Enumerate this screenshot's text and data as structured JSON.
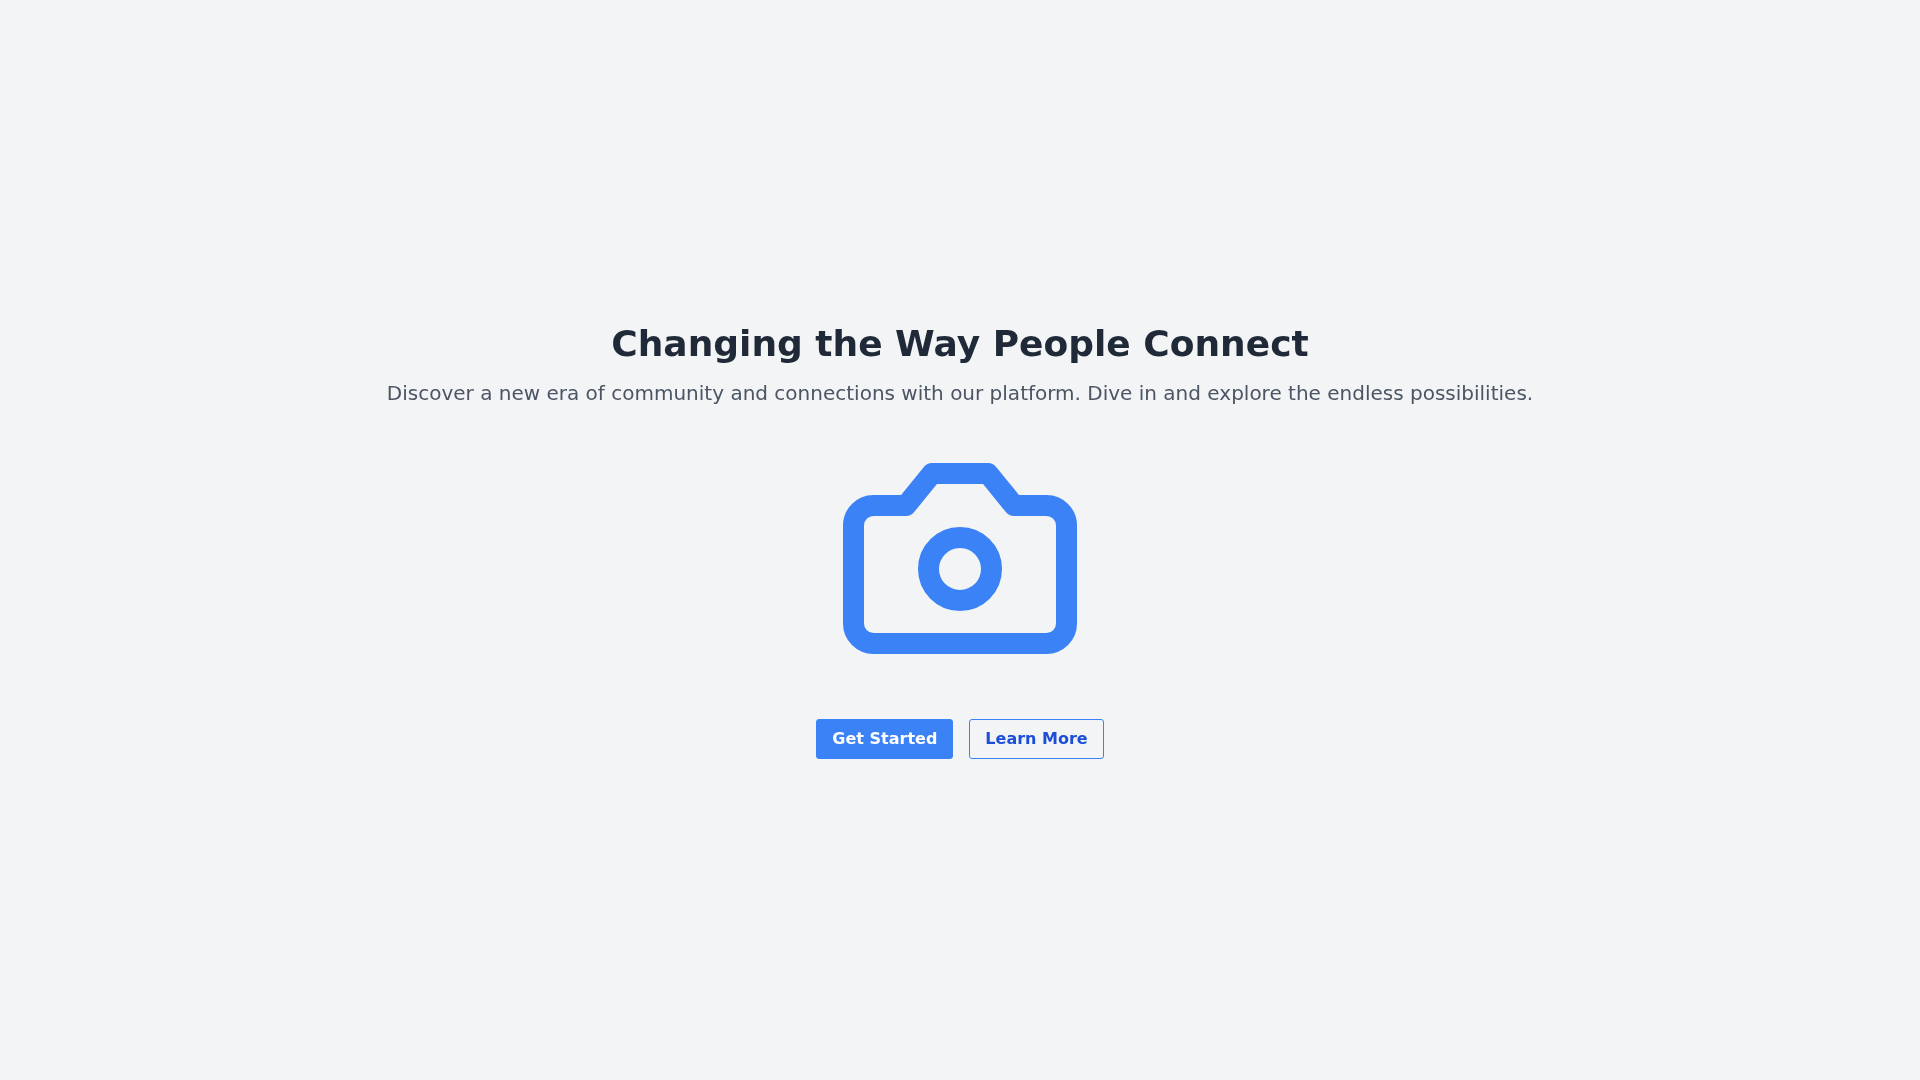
{
  "hero": {
    "title": "Changing the Way People Connect",
    "subtitle": "Discover a new era of community and connections with our platform. Dive in and explore the endless possibilities.",
    "buttons": [
      {
        "label": "Get Started",
        "kind": "primary"
      },
      {
        "label": "Learn More",
        "kind": "outline"
      }
    ]
  }
}
